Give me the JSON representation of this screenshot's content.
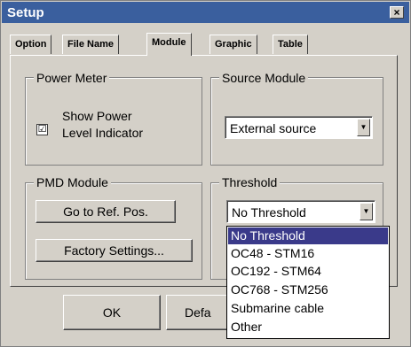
{
  "window": {
    "title": "Setup",
    "close_glyph": "×"
  },
  "tabs": [
    {
      "label": "Option",
      "active": false
    },
    {
      "label": "File Name",
      "active": false
    },
    {
      "label": "Module",
      "active": true
    },
    {
      "label": "Graphic",
      "active": false
    },
    {
      "label": "Table",
      "active": false
    }
  ],
  "power_meter": {
    "group_label": "Power Meter",
    "checkbox_checked": true,
    "checkbox_mark": "☑",
    "checkbox_label_line1": "Show Power",
    "checkbox_label_line2": "Level Indicator"
  },
  "source_module": {
    "group_label": "Source Module",
    "selected": "External source"
  },
  "pmd_module": {
    "group_label": "PMD Module",
    "goto_button": "Go to Ref. Pos.",
    "factory_button": "Factory Settings..."
  },
  "threshold": {
    "group_label": "Threshold",
    "selected": "No Threshold",
    "options": [
      "No Threshold",
      "OC48 - STM16",
      "OC192 - STM64",
      "OC768 - STM256",
      "Submarine cable",
      "Other"
    ]
  },
  "footer": {
    "ok_label": "OK",
    "default_label": "Defa"
  },
  "colors": {
    "titlebar": "#3a5f9e",
    "dialog_bg": "#d4d0c8",
    "selection": "#3a3a8a"
  }
}
